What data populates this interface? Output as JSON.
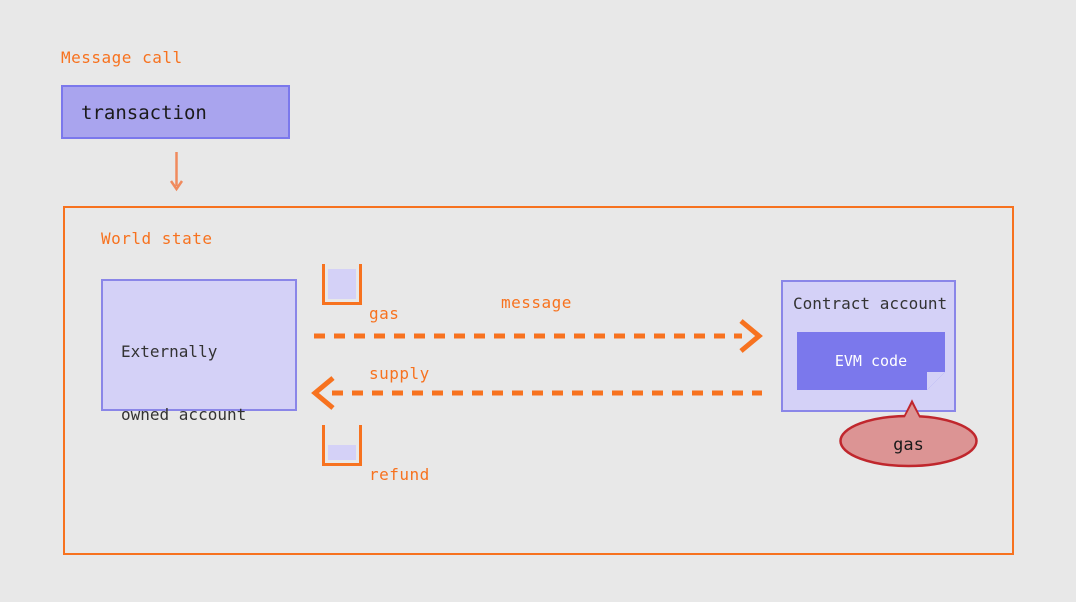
{
  "diagram": {
    "title": "Message call",
    "background_color": "#e8e8e8",
    "accent_orange": "#f7721f",
    "purple_dark": "#7b78ec",
    "purple_mid": "#a9a4ee",
    "purple_light": "#d4d1f7",
    "red_bubble_fill": "#dc9494",
    "red_bubble_stroke": "#c0272d",
    "text_dark": "#333333"
  },
  "message_call": {
    "heading": "Message call",
    "transaction_box": {
      "label": "transaction"
    },
    "flow_arrow": {
      "name": "transaction-to-world-state-arrow",
      "direction": "down",
      "color": "#f08a5d"
    }
  },
  "world_state": {
    "heading": "World state",
    "externally_owned_account": {
      "line1": "Externally",
      "line2": "owned account"
    },
    "gas_supply": {
      "line1": "gas",
      "line2": "supply",
      "fill_percent": 80
    },
    "refund": {
      "line1": "refund",
      "line2": "",
      "fill_percent": 40
    },
    "message_arrow": {
      "label": "message",
      "direction": "right",
      "style": "dashed"
    },
    "refund_arrow": {
      "label": "",
      "direction": "left",
      "style": "dashed"
    },
    "contract_account": {
      "title": "Contract account",
      "evm_code_label": "EVM code"
    },
    "gas_bubble": {
      "label": "gas"
    }
  }
}
